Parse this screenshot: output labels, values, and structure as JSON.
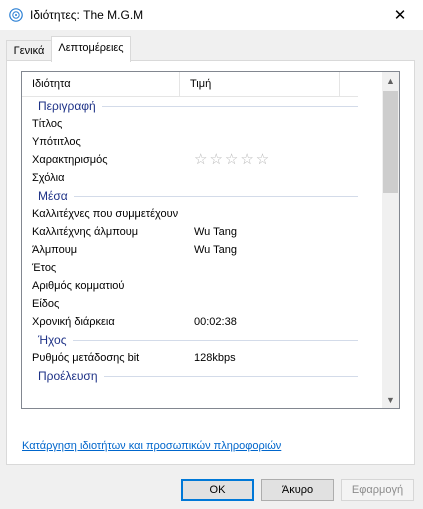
{
  "window": {
    "title": "Ιδιότητες: The M.G.M",
    "close_symbol": "✕",
    "icon": "audio-file-icon"
  },
  "tabs": [
    {
      "label": "Γενικά",
      "selected": false
    },
    {
      "label": "Λεπτομέρειες",
      "selected": true
    }
  ],
  "list": {
    "columns": {
      "property": "Ιδιότητα",
      "value": "Τιμή"
    },
    "groups": {
      "description": "Περιγραφή",
      "media": "Μέσα",
      "audio": "Ήχος",
      "origin": "Προέλευση"
    },
    "rows": {
      "title": {
        "label": "Τίτλος",
        "value": ""
      },
      "subtitle": {
        "label": "Υπότιτλος",
        "value": ""
      },
      "rating": {
        "label": "Χαρακτηρισμός",
        "value": "☆☆☆☆☆"
      },
      "comments": {
        "label": "Σχόλια",
        "value": ""
      },
      "contributing_artists": {
        "label": "Καλλιτέχνες που συμμετέχουν",
        "value": ""
      },
      "album_artist": {
        "label": "Καλλιτέχνης άλμπουμ",
        "value": "Wu Tang"
      },
      "album": {
        "label": "Άλμπουμ",
        "value": "Wu Tang"
      },
      "year": {
        "label": "Έτος",
        "value": ""
      },
      "track_number": {
        "label": "Αριθμός κομματιού",
        "value": ""
      },
      "genre": {
        "label": "Είδος",
        "value": ""
      },
      "length": {
        "label": "Χρονική διάρκεια",
        "value": "00:02:38"
      },
      "bit_rate": {
        "label": "Ρυθμός μετάδοσης bit",
        "value": "128kbps"
      }
    }
  },
  "scrollbar": {
    "up_arrow": "▲",
    "down_arrow": "▼"
  },
  "remove_link": "Κατάργηση ιδιοτήτων και προσωπικών πληροφοριών",
  "buttons": {
    "ok": "OK",
    "cancel": "Άκυρο",
    "apply": "Εφαρμογή"
  },
  "colors": {
    "accent": "#0078d7",
    "group_header": "#1e3287",
    "link": "#0066cc"
  }
}
